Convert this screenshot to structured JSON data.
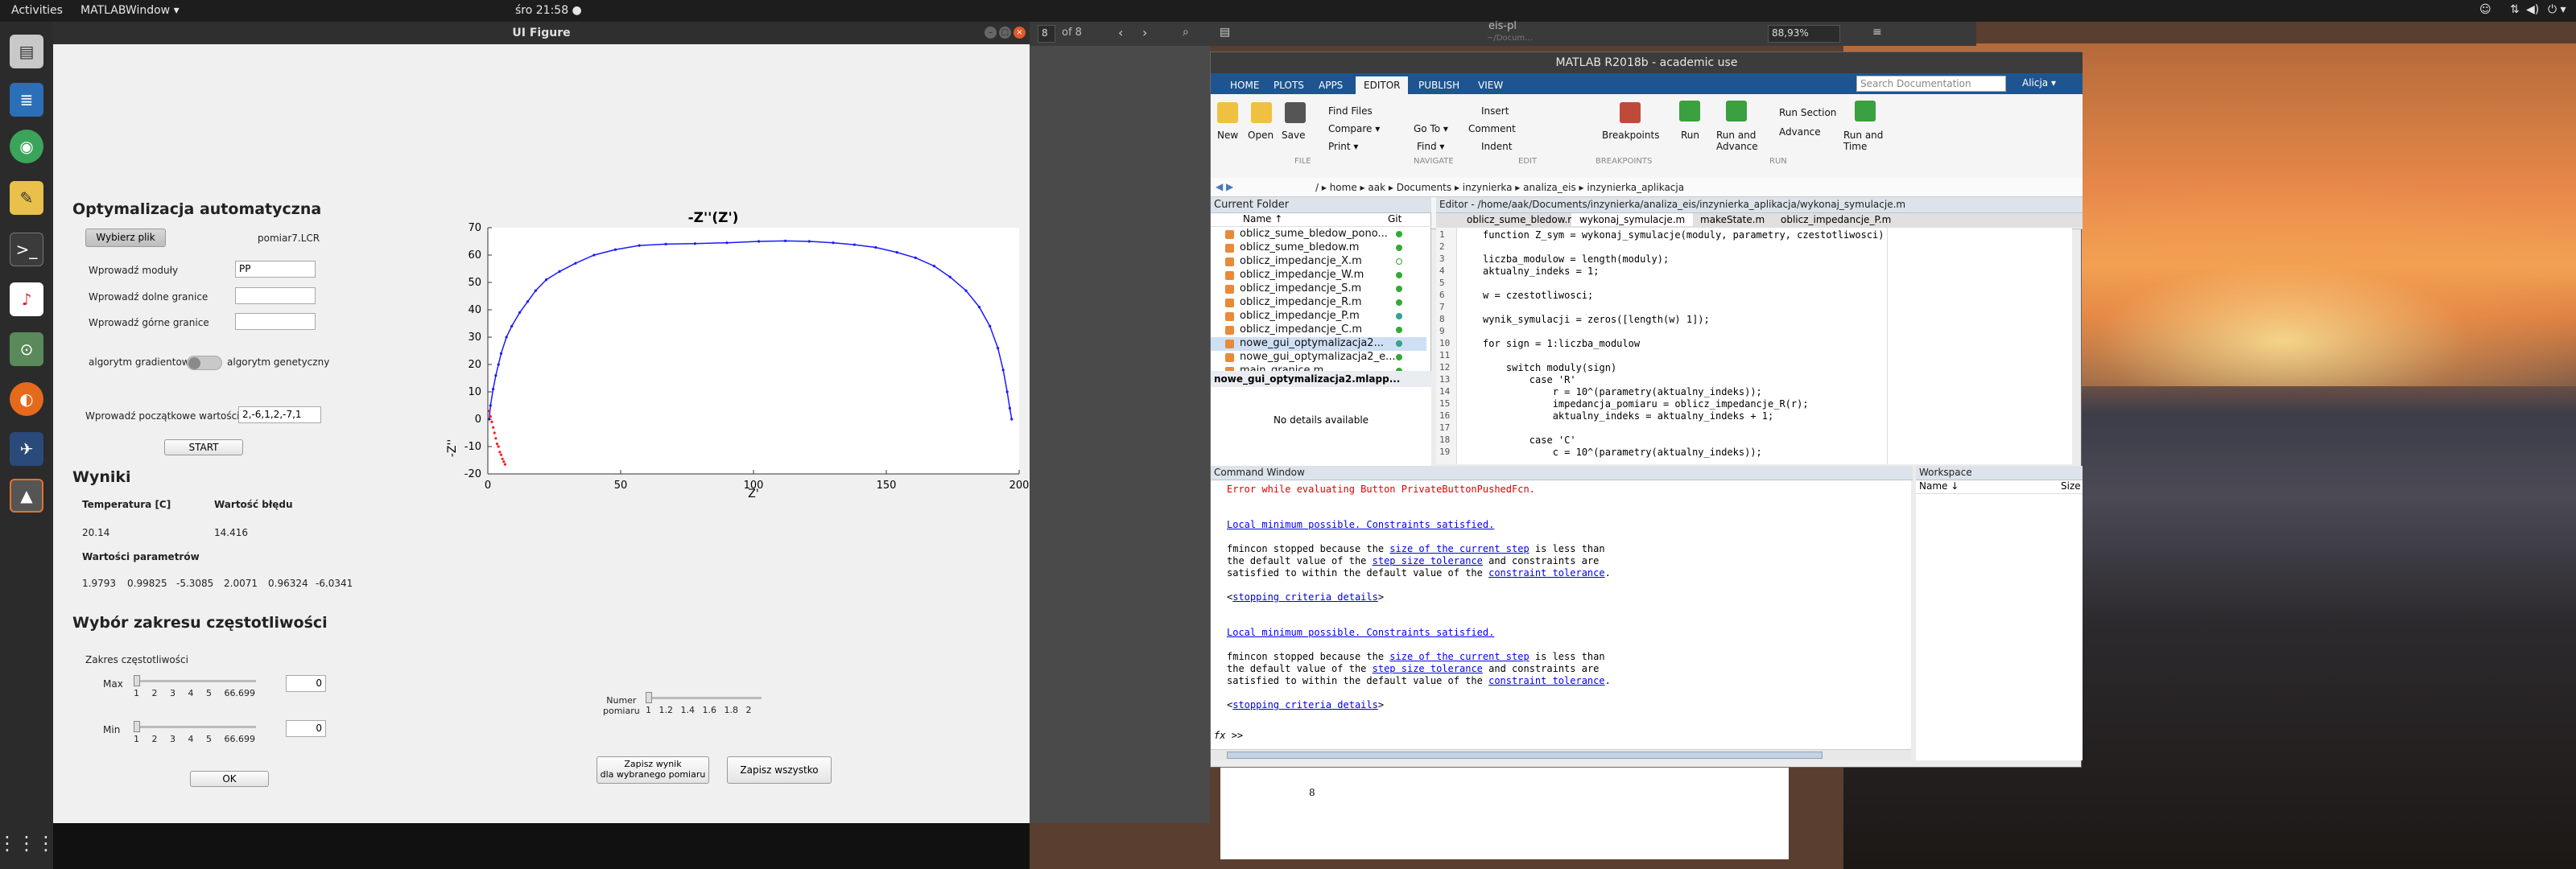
{
  "topbar": {
    "activities": "Activities",
    "app_menu": "MATLABWindow ▾",
    "clock": "śro 21:58 ●"
  },
  "uifig": {
    "title": "UI Figure",
    "opt_heading": "Optymalizacja automatyczna",
    "choose_file_btn": "Wybierz plik",
    "file_name": "pomiar7.LCR",
    "moduly_label": "Wprowadź moduły",
    "moduly_value": "PP",
    "lower_label": "Wprowadź dolne granice",
    "upper_label": "Wprowadź górne granice",
    "alg_gradient": "algorytm gradientowy",
    "alg_genetic": "algorytm genetyczny",
    "initial_label": "Wprowadź początkowe wartości",
    "initial_value": "2,-6,1,2,-7,1",
    "start_btn": "START",
    "results_heading": "Wyniki",
    "temp_label": "Temperatura [C]",
    "err_label": "Wartość błędu",
    "temp_value": "20.14",
    "err_value": "14.416",
    "params_label": "Wartości parametrów",
    "params": [
      "1.9793",
      "0.99825",
      "-5.3085",
      "2.0071",
      "0.96324",
      "-6.0341"
    ],
    "freq_heading": "Wybór zakresu częstotliwości",
    "freq_range_label": "Zakres częstotliwości",
    "max_label": "Max",
    "min_label": "Min",
    "slider_ticks": [
      "1",
      "2",
      "3",
      "4",
      "5",
      "66.699"
    ],
    "max_value": "0",
    "min_value": "0",
    "ok_btn": "OK",
    "numer_label_1": "Numer",
    "numer_label_2": "pomiaru",
    "numer_ticks": [
      "1",
      "1.2",
      "1.4",
      "1.6",
      "1.8",
      "2"
    ],
    "save_one_1": "Zapisz wynik",
    "save_one_2": "dla wybranego pomiaru",
    "save_all": "Zapisz wszystko"
  },
  "chart_data": {
    "type": "scatter",
    "title": "-Z''(Z')",
    "xlabel": "Z'",
    "ylabel": "-Z''",
    "xlim": [
      0,
      200
    ],
    "ylim": [
      -20,
      70
    ],
    "xticks": [
      "0",
      "50",
      "100",
      "150",
      "200"
    ],
    "yticks": [
      "70",
      "60",
      "50",
      "40",
      "30",
      "20",
      "10",
      "0",
      "-10",
      "-20"
    ],
    "grid": false,
    "series": [
      {
        "color": "#1a1aff",
        "x": [
          0.5,
          1,
          2,
          3,
          4,
          5,
          7,
          9,
          12,
          15,
          18,
          22,
          27,
          33,
          40,
          48,
          57,
          67,
          78,
          90,
          102,
          112,
          121,
          130,
          138,
          146,
          154,
          161,
          168,
          174,
          180,
          185,
          189,
          192,
          194,
          195.5,
          196.5,
          197.2
        ],
        "y": [
          0,
          5,
          11,
          16,
          20,
          24,
          30,
          34,
          39,
          43,
          47,
          51,
          54,
          57,
          60,
          62,
          63.5,
          64,
          64.2,
          64.5,
          65,
          65.2,
          65,
          64.5,
          63.8,
          62.8,
          61,
          59,
          56,
          52,
          47,
          41,
          34,
          26,
          18,
          10,
          4,
          0
        ]
      },
      {
        "color": "#ff1a1a",
        "x": [
          0.5,
          1,
          1.5,
          2,
          2.5,
          3,
          3.5,
          4,
          4.5,
          5,
          5.5,
          6,
          6.5
        ],
        "y": [
          3,
          1,
          -1,
          -3,
          -5,
          -7,
          -9,
          -10,
          -12,
          -13,
          -14.5,
          -15.5,
          -16.5
        ]
      }
    ]
  },
  "pdfbar": {
    "page_field": "8",
    "page_of": "of 8",
    "doc_title": "eis-pl",
    "doc_sub": "~/Docum…",
    "zoom": "88,93%"
  },
  "pdfpage": {
    "page_number": "8"
  },
  "matlab": {
    "title": "MATLAB R2018b - academic use",
    "tabs": [
      "HOME",
      "PLOTS",
      "APPS",
      "EDITOR",
      "PUBLISH",
      "VIEW"
    ],
    "search_placeholder": "Search Documentation",
    "user": "Alicja ▾",
    "ribbon": {
      "new": "New",
      "open": "Open",
      "save": "Save",
      "find_files": "Find Files",
      "compare": "Compare ▾",
      "print": "Print ▾",
      "goto": "Go To ▾",
      "find": "Find ▾",
      "insert": "Insert",
      "comment": "Comment",
      "indent": "Indent",
      "breakpoints": "Breakpoints",
      "run": "Run",
      "run_advance": "Run and Advance",
      "run_section": "Run Section",
      "advance": "Advance",
      "run_time": "Run and Time",
      "grp_file": "FILE",
      "grp_navigate": "NAVIGATE",
      "grp_edit": "EDIT",
      "grp_breakpoints": "BREAKPOINTS",
      "grp_run": "RUN"
    },
    "path": [
      "home",
      "aak",
      "Documents",
      "inzynierka",
      "analiza_eis",
      "inzynierka_aplikacja"
    ],
    "current_folder": {
      "title": "Current Folder",
      "col_name": "Name ↑",
      "col_git": "Git",
      "files": [
        "oblicz_sume_bledow_pono...",
        "oblicz_sume_bledow.m",
        "oblicz_impedancje_X.m",
        "oblicz_impedancje_W.m",
        "oblicz_impedancje_S.m",
        "oblicz_impedancje_R.m",
        "oblicz_impedancje_P.m",
        "oblicz_impedancje_C.m",
        "nowe_gui_optymalizacja2...",
        "nowe_gui_optymalizacja2_e...",
        "main_granice.m"
      ],
      "details_title": "nowe_gui_optymalizacja2.mlapp...",
      "details_text": "No details available"
    },
    "editor": {
      "title": "Editor - /home/aak/Documents/inzynierka/analiza_eis/inzynierka_aplikacja/wykonaj_symulacje.m",
      "tabs": [
        "oblicz_sume_bledow.m",
        "wykonaj_symulacje.m",
        "makeState.m",
        "oblicz_impedancje_P.m"
      ],
      "lines": [
        "function Z_sym = wykonaj_symulacje(moduly, parametry, czestotliwosci)",
        "",
        "liczba_modulow = length(moduly);",
        "aktualny_indeks = 1;",
        "",
        "w = czestotliwosci;",
        "",
        "wynik_symulacji = zeros([length(w) 1]);",
        "",
        "for sign = 1:liczba_modulow",
        "",
        "    switch moduly(sign)",
        "        case 'R'",
        "            r = 10^(parametry(aktualny_indeks));",
        "            impedancja_pomiaru = oblicz_impedancje_R(r);",
        "            aktualny_indeks = aktualny_indeks + 1;",
        "",
        "        case 'C'",
        "            c = 10^(parametry(aktualny_indeks));"
      ]
    },
    "command_window": {
      "title": "Command Window",
      "error": "Error while evaluating Button PrivateButtonPushedFcn.",
      "local_min": "Local minimum possible. Constraints satisfied.",
      "fmincon_1a": "fmincon stopped because the ",
      "fmincon_1b": "size of the current step",
      "fmincon_1c": " is less than",
      "fmincon_2a": "the default value of the ",
      "fmincon_2b": "step size tolerance",
      "fmincon_2c": " and constraints are",
      "fmincon_3a": "satisfied to within the default value of the ",
      "fmincon_3b": "constraint tolerance",
      "fmincon_3c": ".",
      "criteria_a": "<",
      "criteria_b": "stopping criteria details",
      "criteria_c": ">",
      "prompt": ">>"
    },
    "workspace": {
      "title": "Workspace",
      "col_name": "Name ↓",
      "col_size": "Size"
    }
  },
  "colors": {
    "matlab_tab_bar": "#1e5590",
    "plot_blue": "#1a1aff",
    "plot_red": "#ff1a1a",
    "error_red": "#e00000",
    "link_blue": "#0000ee"
  }
}
